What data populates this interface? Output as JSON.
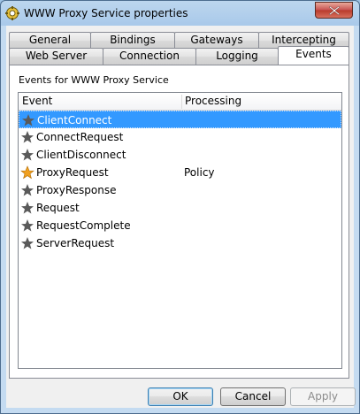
{
  "window": {
    "title": "WWW Proxy Service properties"
  },
  "tabs_row_back": [
    {
      "label": "General"
    },
    {
      "label": "Bindings"
    },
    {
      "label": "Gateways"
    },
    {
      "label": "Intercepting"
    }
  ],
  "tabs_row_front": [
    {
      "label": "Web Server"
    },
    {
      "label": "Connection"
    },
    {
      "label": "Logging"
    },
    {
      "label": "Events",
      "active": true
    }
  ],
  "events_group": {
    "label": "Events for WWW Proxy Service"
  },
  "list": {
    "columns": [
      "Event",
      "Processing"
    ],
    "rows": [
      {
        "event": "ClientConnect",
        "processing": "",
        "selected": true,
        "star": "gray"
      },
      {
        "event": "ConnectRequest",
        "processing": "",
        "star": "gray"
      },
      {
        "event": "ClientDisconnect",
        "processing": "",
        "star": "gray"
      },
      {
        "event": "ProxyRequest",
        "processing": "Policy",
        "star": "gold"
      },
      {
        "event": "ProxyResponse",
        "processing": "",
        "star": "gray"
      },
      {
        "event": "Request",
        "processing": "",
        "star": "gray"
      },
      {
        "event": "RequestComplete",
        "processing": "",
        "star": "gray"
      },
      {
        "event": "ServerRequest",
        "processing": "",
        "star": "gray"
      }
    ]
  },
  "buttons": {
    "ok": "OK",
    "cancel": "Cancel",
    "apply": "Apply"
  },
  "colors": {
    "selection": "#3399ff",
    "star_gray": "#5a5a5a",
    "star_gold": "#f0a020"
  },
  "icons": {
    "app": "gear-shield-icon",
    "close": "close-icon",
    "event": "star-icon"
  }
}
